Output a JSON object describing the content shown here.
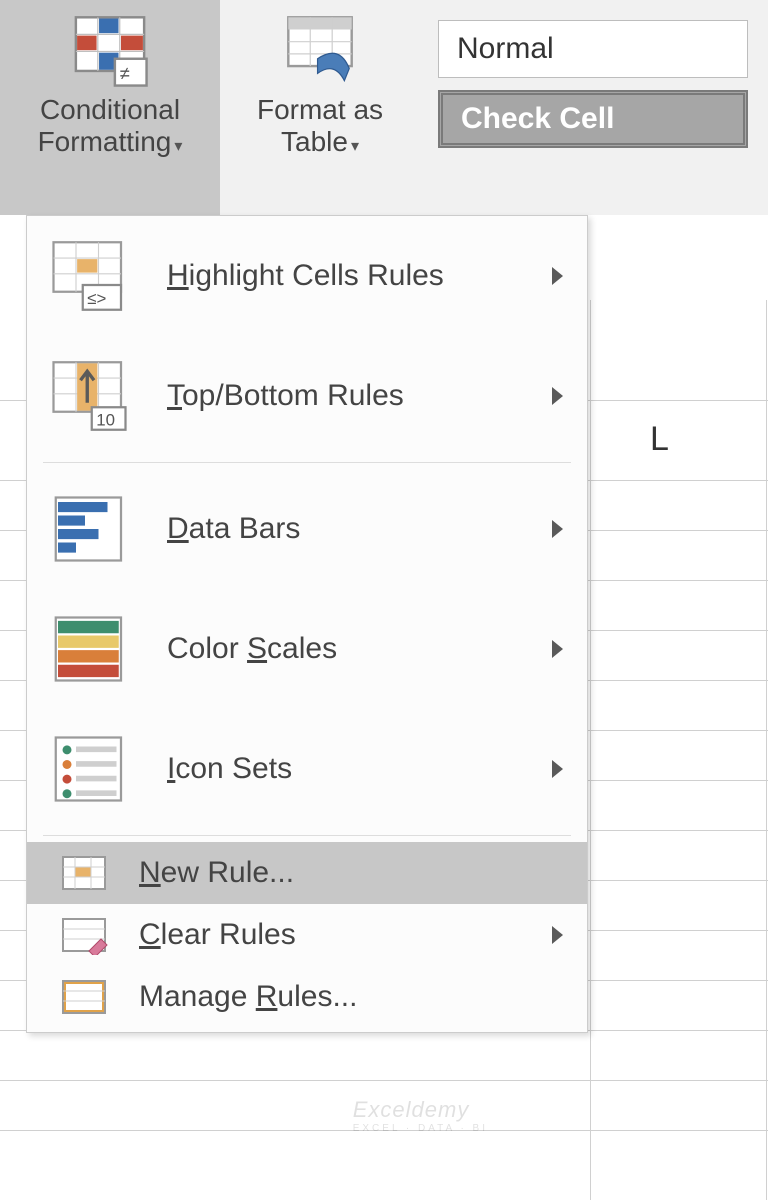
{
  "ribbon": {
    "cond_format": {
      "label1": "Conditional",
      "label2": "Formatting"
    },
    "format_table": {
      "label1": "Format as",
      "label2": "Table"
    },
    "styles": {
      "normal": "Normal",
      "check_cell": "Check Cell"
    }
  },
  "menu": {
    "highlight": "Highlight Cells Rules",
    "topbottom": "Top/Bottom Rules",
    "databars": "Data Bars",
    "colorscales": "Color Scales",
    "iconsets": "Icon Sets",
    "newrule": "New Rule...",
    "clearrules": "Clear Rules",
    "managerules": "Manage Rules..."
  },
  "grid": {
    "col_header": "L"
  },
  "watermark": {
    "brand": "Exceldemy",
    "tag": "EXCEL · DATA · BI"
  }
}
